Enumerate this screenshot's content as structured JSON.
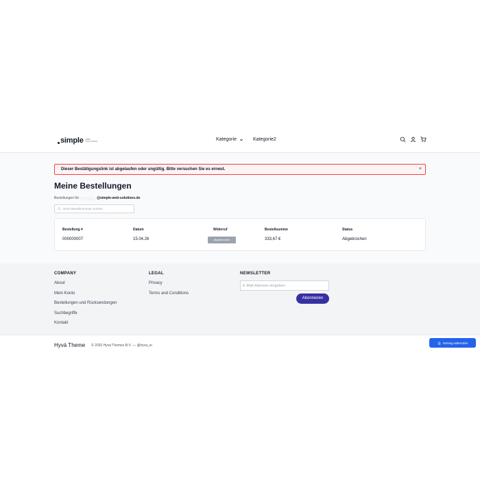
{
  "header": {
    "logo_word": "simple",
    "logo_sub_line1": "web",
    "logo_sub_line2": "solutions",
    "nav": [
      {
        "label": "Kategorie"
      },
      {
        "label": "Kategorie2"
      }
    ],
    "icons": [
      "search-icon",
      "user-icon",
      "cart-icon"
    ]
  },
  "alert": {
    "message": "Dieser Bestätigungslink ist abgelaufen oder ungültig. Bitte versuchen Sie es erneut.",
    "close": "×"
  },
  "main": {
    "title": "Meine Bestellungen",
    "orders_for_label": "Bestellungen für",
    "email_domain": "@simple-web-solutions.de",
    "search_placeholder": "Nach Bestellnummer suchen...",
    "table": {
      "headers": {
        "order": "Bestellung #",
        "date": "Datum",
        "revocation": "Widerruf",
        "total": "Bestellsumme",
        "status": "Status"
      },
      "rows": [
        {
          "order": "000000007",
          "date": "15.04.26",
          "revocation_button": "Abgebrochen",
          "total": "333,67 €",
          "status": "Abgebrochen"
        }
      ]
    }
  },
  "footer": {
    "company": {
      "title": "COMPANY",
      "links": [
        "About",
        "Mein Konto",
        "Bestellungen und Rücksendungen",
        "Suchbegriffe",
        "Kontakt"
      ]
    },
    "legal": {
      "title": "LEGAL",
      "links": [
        "Privacy",
        "Terms and Conditions"
      ]
    },
    "newsletter": {
      "title": "NEWSLETTER",
      "placeholder": "E-Mail-Adresse eingeben",
      "button": "Abonnieren"
    }
  },
  "bottom": {
    "brand": "Hyvä Theme",
    "copyright": "© 2020 Hyvä Themes B.V. — @hyva_io"
  },
  "withdraw_button": "Vertrag widerrufen",
  "colors": {
    "accent": "#3730a3",
    "alert_border": "#ef4444",
    "withdraw": "#2563eb"
  }
}
